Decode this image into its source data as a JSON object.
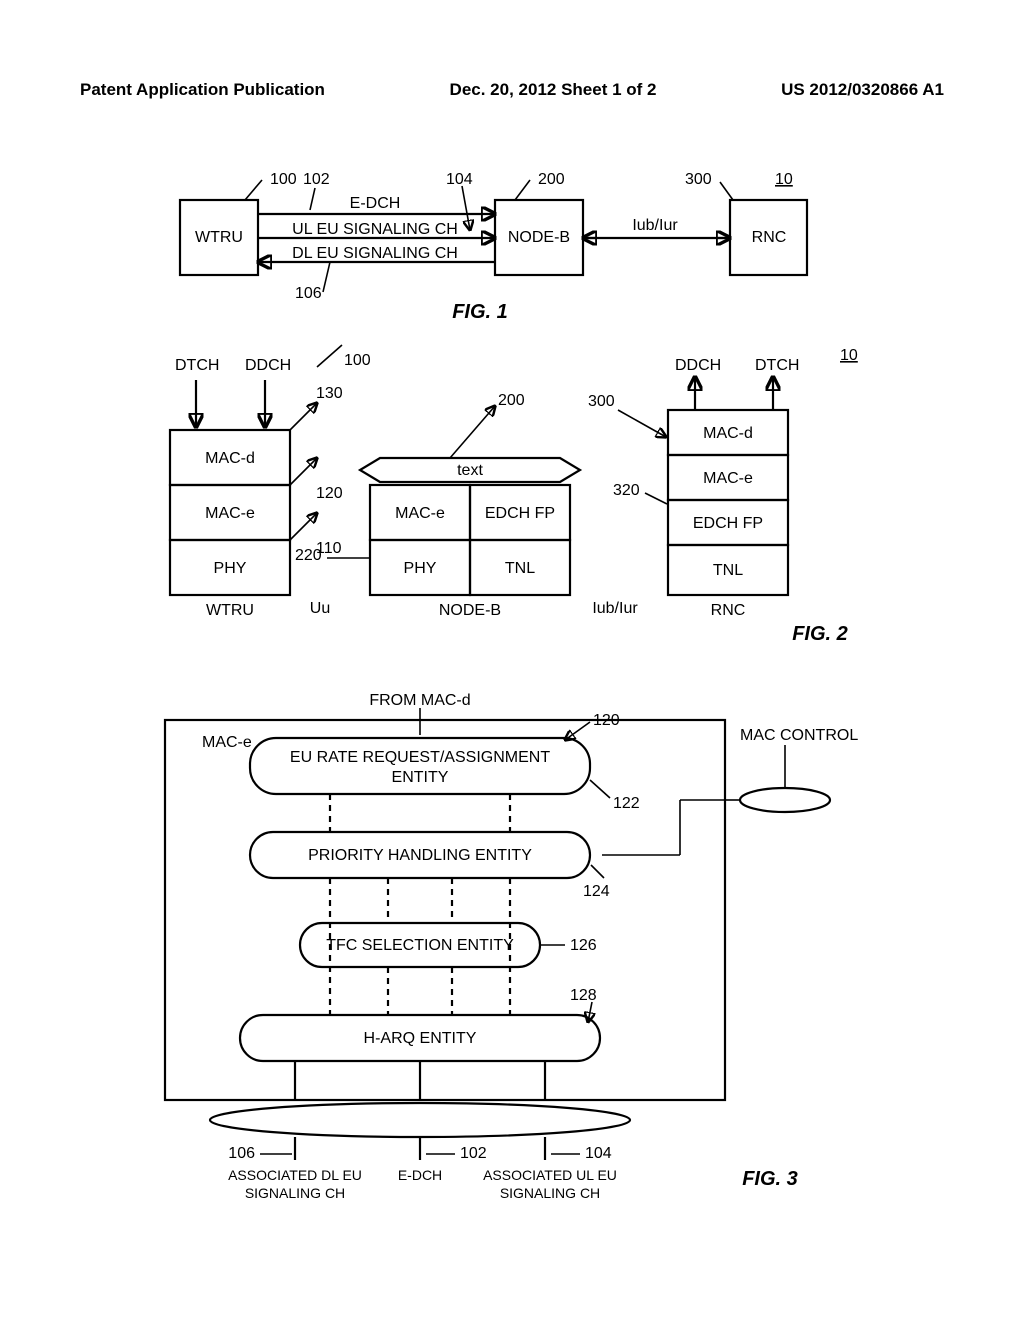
{
  "header": {
    "left": "Patent Application Publication",
    "center": "Dec. 20, 2012  Sheet 1 of 2",
    "right": "US 2012/0320866 A1"
  },
  "fig1": {
    "title": "FIG. 1",
    "wtru": "WTRU",
    "nodeb": "NODE-B",
    "rnc": "RNC",
    "edch": "E-DCH",
    "ul": "UL EU SIGNALING CH",
    "dl": "DL EU SIGNALING CH",
    "iub": "Iub/Iur",
    "ref100": "100",
    "ref102": "102",
    "ref104": "104",
    "ref106": "106",
    "ref200": "200",
    "ref300": "300",
    "ref10": "10"
  },
  "fig2": {
    "title": "FIG. 2",
    "dtch": "DTCH",
    "ddch": "DDCH",
    "macd": "MAC-d",
    "mace": "MAC-e",
    "phy": "PHY",
    "edchfp": "EDCH FP",
    "tnl": "TNL",
    "text": "text",
    "uu": "Uu",
    "iub": "Iub/Iur",
    "wtru": "WTRU",
    "nodeb": "NODE-B",
    "rnc": "RNC",
    "ref100": "100",
    "ref110": "110",
    "ref120": "120",
    "ref130": "130",
    "ref200": "200",
    "ref220": "220",
    "ref300": "300",
    "ref320": "320",
    "ref10": "10"
  },
  "fig3": {
    "title": "FIG. 3",
    "from": "FROM MAC-d",
    "mace": "MAC-e",
    "control": "MAC CONTROL",
    "rate1": "EU RATE REQUEST/ASSIGNMENT",
    "rate2": "ENTITY",
    "priority": "PRIORITY HANDLING ENTITY",
    "tfc": "TFC SELECTION ENTITY",
    "harq": "H-ARQ ENTITY",
    "dlCh1": "ASSOCIATED DL EU",
    "dlCh2": "SIGNALING CH",
    "edch": "E-DCH",
    "ulCh1": "ASSOCIATED UL EU",
    "ulCh2": "SIGNALING CH",
    "ref102": "102",
    "ref104": "104",
    "ref106": "106",
    "ref120": "120",
    "ref122": "122",
    "ref124": "124",
    "ref126": "126",
    "ref128": "128"
  }
}
